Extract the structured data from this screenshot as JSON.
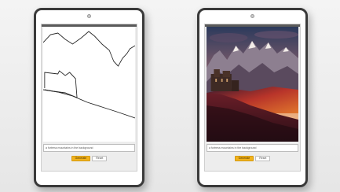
{
  "left_tablet": {
    "caption": "a fortress mountains in the background",
    "generate_label": "Generate",
    "reset_label": "Reset"
  },
  "right_tablet": {
    "caption": "a fortress mountains in the background",
    "generate_label": "Generate",
    "reset_label": "Reset"
  },
  "colors": {
    "tablet_frame": "#3a3a3a",
    "generate_button": "#f2b21c",
    "sky_top": "#2c3a5c",
    "valley_red": "#b8342a"
  }
}
